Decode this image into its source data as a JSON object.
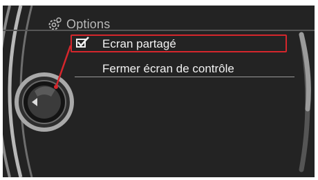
{
  "header": {
    "title": "Options",
    "icon": "settings-gear-icon"
  },
  "menu": {
    "items": [
      {
        "label": "Ecran partagé",
        "selected": true,
        "checked": true
      },
      {
        "label": "Fermer écran de contrôle",
        "selected": false,
        "checked": false
      }
    ]
  },
  "colors": {
    "background": "#232323",
    "text": "#f2f2f2",
    "header_text": "#b9b9b9",
    "highlight": "#d6262c"
  }
}
